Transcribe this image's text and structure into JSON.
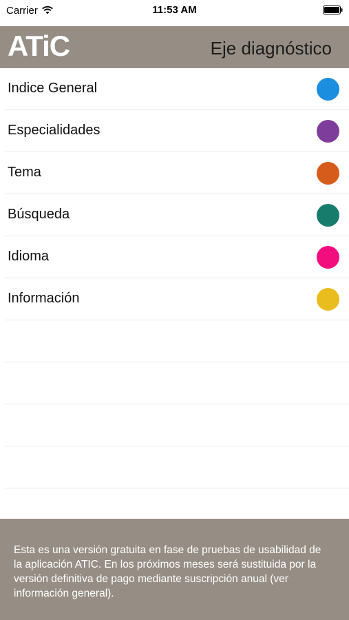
{
  "status_bar": {
    "carrier": "Carrier",
    "time": "11:53 AM"
  },
  "header": {
    "logo": "ATiC",
    "title": "Eje diagnóstico",
    "background": "#968e85"
  },
  "menu": {
    "items": [
      {
        "label": "Indice General",
        "color": "#1c8ee0"
      },
      {
        "label": "Especialidades",
        "color": "#7f3d9b"
      },
      {
        "label": "Tema",
        "color": "#d65c1c"
      },
      {
        "label": "Búsqueda",
        "color": "#177c6c"
      },
      {
        "label": "Idioma",
        "color": "#f20f7d"
      },
      {
        "label": "Información",
        "color": "#e9bd1e"
      }
    ]
  },
  "footer": {
    "text": "Esta es una versión gratuita en fase de pruebas de usabilidad de la aplicación ATIC. En los próximos meses será sustituida por la versión definitiva de pago mediante suscripción anual (ver información general)."
  }
}
